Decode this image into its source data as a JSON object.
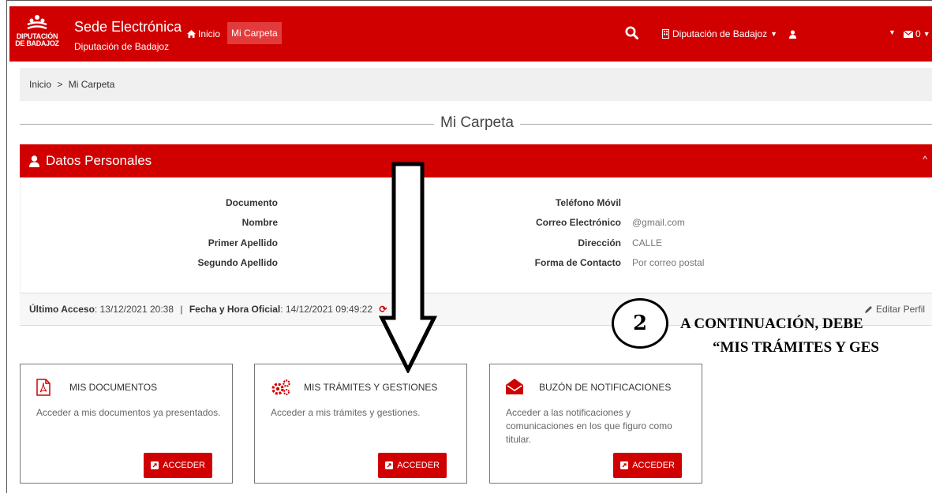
{
  "header": {
    "logo_line1": "DIPUTACIÓN",
    "logo_line2": "DE BADAJOZ",
    "brand_title": "Sede Electrónica",
    "brand_subtitle": "Diputación de Badajoz",
    "nav_inicio": "Inicio",
    "nav_carpeta": "Mi Carpeta",
    "org_label": "Diputación de Badajoz",
    "mail_count": "0",
    "icons": [
      "home-icon",
      "search-icon",
      "building-icon",
      "user-icon",
      "envelope-icon",
      "chevron-down-icon"
    ]
  },
  "breadcrumb": {
    "home": "Inicio",
    "separator": ">",
    "current": "Mi Carpeta"
  },
  "page_title": "Mi Carpeta",
  "datos": {
    "heading": "Datos Personales",
    "left_fields": [
      {
        "label": "Documento",
        "value": ""
      },
      {
        "label": "Nombre",
        "value": ""
      },
      {
        "label": "Primer Apellido",
        "value": ""
      },
      {
        "label": "Segundo Apellido",
        "value": ""
      }
    ],
    "right_fields": [
      {
        "label": "Teléfono Móvil",
        "value": ""
      },
      {
        "label": "Correo Electrónico",
        "value": "@gmail.com"
      },
      {
        "label": "Dirección",
        "value": "CALLE"
      },
      {
        "label": "Forma de Contacto",
        "value": "Por correo postal"
      }
    ]
  },
  "access": {
    "last_label": "Último Acceso",
    "last_value": ": 13/12/2021 20:38",
    "sep": "|",
    "official_label": "Fecha y Hora Oficial",
    "official_value": ": 14/12/2021 09:49:22",
    "edit_profile": "Editar Perfil"
  },
  "cards": [
    {
      "title": "MIS DOCUMENTOS",
      "desc": "Acceder a mis documentos ya presentados.",
      "button": "ACCEDER",
      "icon": "pdf-icon"
    },
    {
      "title": "MIS TRÁMITES Y GESTIONES",
      "desc": "Acceder a mis trámites y gestiones.",
      "button": "ACCEDER",
      "icon": "gears-icon"
    },
    {
      "title": "BUZÓN DE NOTIFICACIONES",
      "desc": "Acceder a las notificaciones y comunicaciones en los que figuro como titular.",
      "button": "ACCEDER",
      "icon": "open-envelope-icon"
    }
  ],
  "annotation": {
    "number": "2",
    "line1": "A CONTINUACIÓN, DEBE",
    "line2": "“MIS TRÁMITES Y GES"
  },
  "colors": {
    "brand_red": "#d10000",
    "highlight_red": "#e23b3b"
  }
}
